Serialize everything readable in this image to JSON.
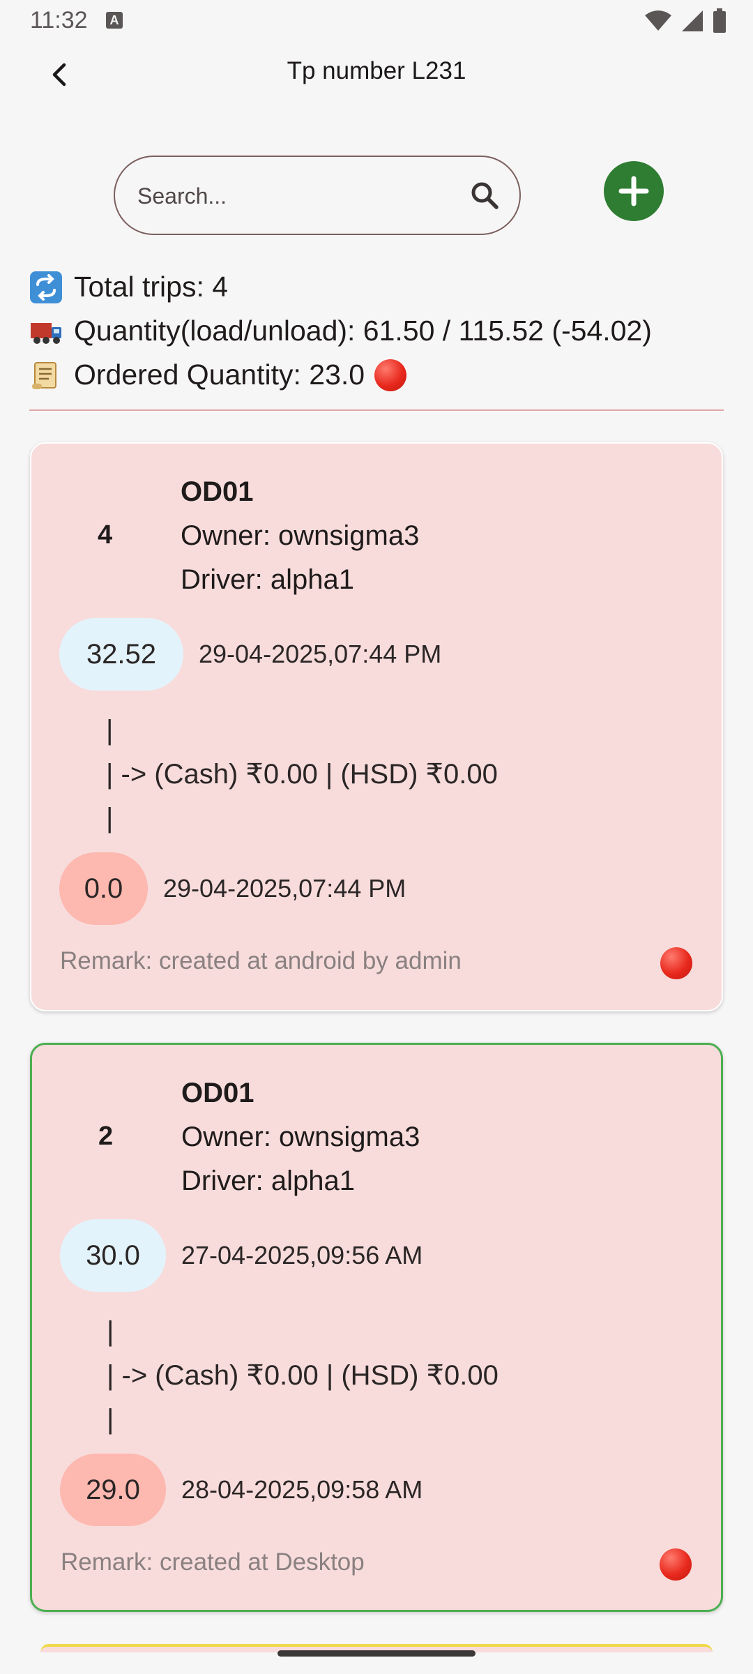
{
  "status_bar": {
    "time": "11:32",
    "notification_icon": "A"
  },
  "header": {
    "title": "Tp number L231",
    "back_icon": "chevron-left"
  },
  "search": {
    "placeholder": "Search...",
    "value": ""
  },
  "summary": {
    "total_trips": "Total trips: 4",
    "quantity": "Quantity(load/unload): 61.50 / 115.52 (-54.02)",
    "ordered_quantity": "Ordered Quantity: 23.0"
  },
  "trips": [
    {
      "index": "4",
      "code": "OD01",
      "owner": "Owner: ownsigma3",
      "driver": "Driver: alpha1",
      "load_qty": "32.52",
      "load_time": "29-04-2025,07:44 PM",
      "pipe_top": "|",
      "payment": "| -> (Cash) ₹0.00 | (HSD) ₹0.00",
      "pipe_bottom": "|",
      "unload_qty": "0.0",
      "unload_time": "29-04-2025,07:44 PM",
      "remark": "Remark: created at android by admin",
      "border_color": "#ffffff"
    },
    {
      "index": "2",
      "code": "OD01",
      "owner": "Owner: ownsigma3",
      "driver": "Driver: alpha1",
      "load_qty": "30.0",
      "load_time": "27-04-2025,09:56 AM",
      "pipe_top": "|",
      "payment": "| -> (Cash) ₹0.00 | (HSD) ₹0.00",
      "pipe_bottom": "|",
      "unload_qty": "29.0",
      "unload_time": "28-04-2025,09:58 AM",
      "remark": "Remark: created at Desktop",
      "border_color": "#4caf50"
    }
  ],
  "colors": {
    "card_bg": "#f8dcdc",
    "load_pill": "#e3f3fb",
    "unload_pill": "#fdb8b0",
    "add_button": "#2e7d32",
    "status_dot": "#e8291d"
  }
}
